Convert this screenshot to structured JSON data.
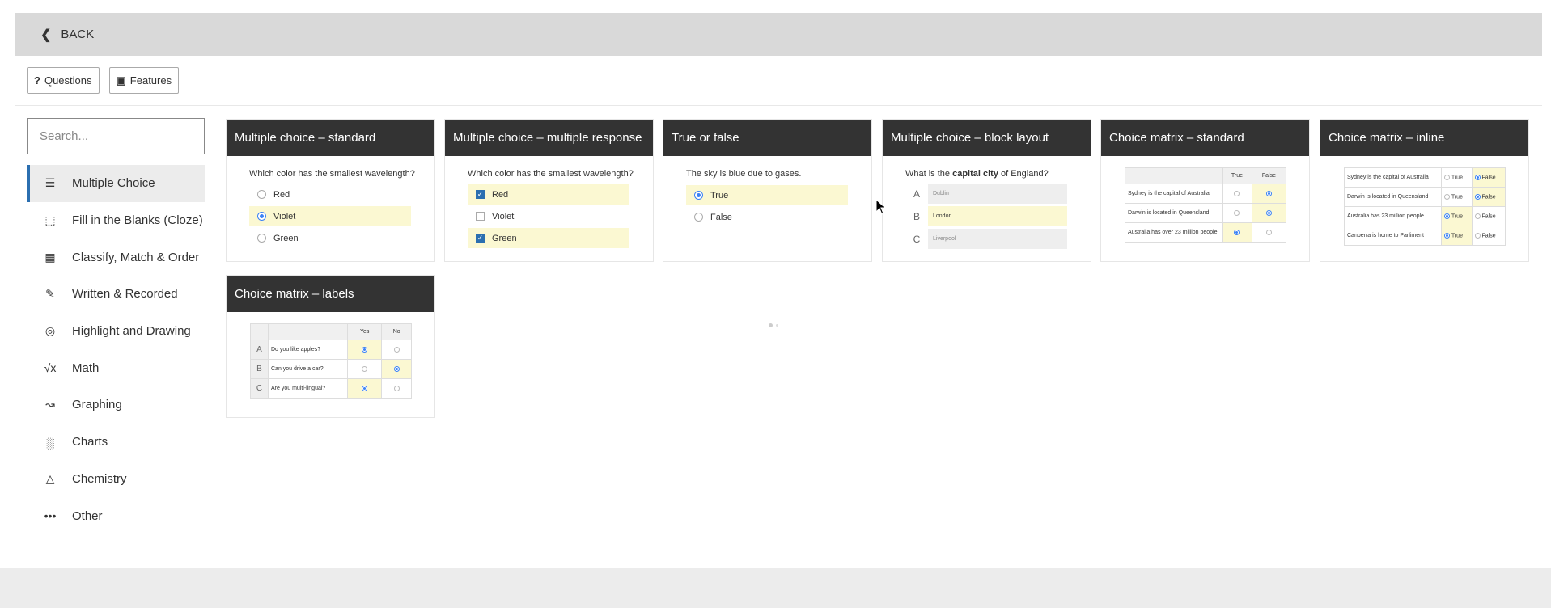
{
  "header": {
    "back_label": "BACK"
  },
  "tabs": [
    {
      "label": "Questions",
      "icon": "question-icon"
    },
    {
      "label": "Features",
      "icon": "image-icon"
    }
  ],
  "search": {
    "placeholder": "Search..."
  },
  "categories": [
    {
      "label": "Multiple Choice",
      "icon": "list-icon",
      "active": true
    },
    {
      "label": "Fill in the Blanks (Cloze)",
      "icon": "dashed-box-icon"
    },
    {
      "label": "Classify, Match & Order",
      "icon": "grid-icon"
    },
    {
      "label": "Written & Recorded",
      "icon": "pencil-icon"
    },
    {
      "label": "Highlight and Drawing",
      "icon": "target-icon"
    },
    {
      "label": "Math",
      "icon": "sqrt-icon"
    },
    {
      "label": "Graphing",
      "icon": "line-graph-icon"
    },
    {
      "label": "Charts",
      "icon": "bar-chart-icon"
    },
    {
      "label": "Chemistry",
      "icon": "flask-icon"
    },
    {
      "label": "Other",
      "icon": "more-dots-icon"
    }
  ],
  "cards": {
    "mc_standard": {
      "title": "Multiple choice – standard",
      "question": "Which color has the smallest wavelength?",
      "options": [
        "Red",
        "Violet",
        "Green"
      ]
    },
    "mc_multiple": {
      "title": "Multiple choice – multiple response",
      "question": "Which color has the smallest wavelength?",
      "options": [
        "Red",
        "Violet",
        "Green"
      ]
    },
    "true_false": {
      "title": "True or false",
      "question": "The sky is blue due to gases.",
      "options": [
        "True",
        "False"
      ]
    },
    "block_layout": {
      "title": "Multiple choice – block layout",
      "question_pre": "What is the ",
      "question_bold": "capital city",
      "question_post": " of England?",
      "letters": [
        "A",
        "B",
        "C"
      ],
      "options": [
        "Dublin",
        "London",
        "Liverpool"
      ]
    },
    "matrix_standard": {
      "title": "Choice matrix – standard",
      "columns": [
        "True",
        "False"
      ],
      "rows": [
        "Sydney is the capital of Australia",
        "Darwin is located in Queensland",
        "Australia has over 23 million people"
      ]
    },
    "matrix_inline": {
      "title": "Choice matrix – inline",
      "true_label": "True",
      "false_label": "False",
      "rows": [
        "Sydney is the capital of Australia",
        "Darwin is located in Queensland",
        "Australia has 23 million people",
        "Canberra is home to Parliment"
      ]
    },
    "matrix_labels": {
      "title": "Choice matrix – labels",
      "columns": [
        "Yes",
        "No"
      ],
      "letters": [
        "A",
        "B",
        "C"
      ],
      "rows": [
        "Do you like apples?",
        "Can you drive a car?",
        "Are you multi-lingual?"
      ]
    }
  },
  "colors": {
    "header_bg": "#333333",
    "accent": "#2b6fb0",
    "selected_bg": "#fbf8d2",
    "radio": "#3b82f6"
  }
}
